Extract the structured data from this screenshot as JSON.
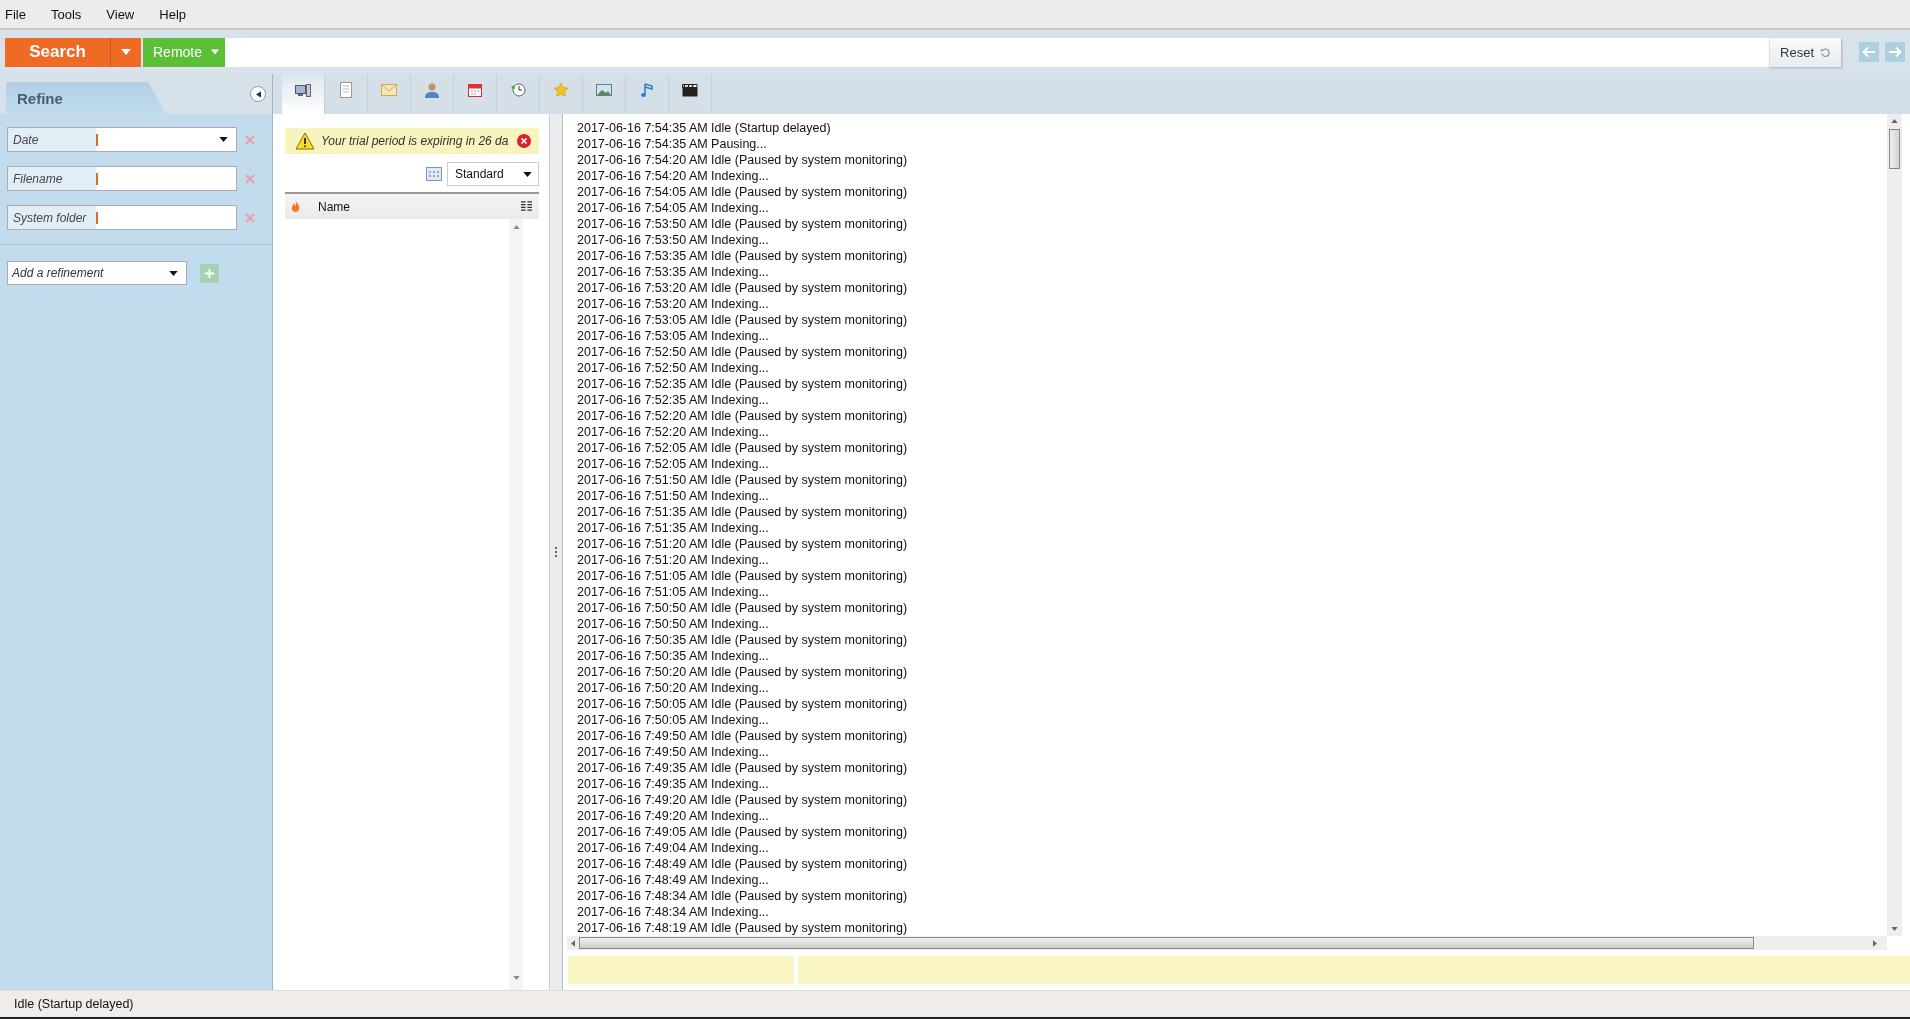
{
  "menu": [
    "File",
    "Tools",
    "View",
    "Help"
  ],
  "toolbar": {
    "search_button": "Search",
    "remote_button": "Remote",
    "reset_button": "Reset"
  },
  "refine": {
    "title": "Refine",
    "filters": [
      {
        "label": "Date",
        "kind": "dropdown"
      },
      {
        "label": "Filename",
        "kind": "text"
      },
      {
        "label": "System folder",
        "kind": "text"
      }
    ],
    "add_refinement": "Add a refinement"
  },
  "tabs": [
    {
      "kind": "computer",
      "selected": true
    },
    {
      "kind": "document",
      "selected": false
    },
    {
      "kind": "email",
      "selected": false
    },
    {
      "kind": "contact",
      "selected": false
    },
    {
      "kind": "calendar",
      "selected": false
    },
    {
      "kind": "history",
      "selected": false
    },
    {
      "kind": "favorite",
      "selected": false
    },
    {
      "kind": "image",
      "selected": false
    },
    {
      "kind": "music",
      "selected": false
    },
    {
      "kind": "video",
      "selected": false
    }
  ],
  "trial_banner": "Your trial period is expiring in 26 da",
  "view_select": "Standard",
  "results_table": {
    "columns": [
      "Name"
    ]
  },
  "log": [
    "2017-06-16 7:54:35 AM Idle (Startup delayed)",
    "2017-06-16 7:54:35 AM Pausing...",
    "2017-06-16 7:54:20 AM Idle (Paused by system monitoring)",
    "2017-06-16 7:54:20 AM Indexing...",
    "2017-06-16 7:54:05 AM Idle (Paused by system monitoring)",
    "2017-06-16 7:54:05 AM Indexing...",
    "2017-06-16 7:53:50 AM Idle (Paused by system monitoring)",
    "2017-06-16 7:53:50 AM Indexing...",
    "2017-06-16 7:53:35 AM Idle (Paused by system monitoring)",
    "2017-06-16 7:53:35 AM Indexing...",
    "2017-06-16 7:53:20 AM Idle (Paused by system monitoring)",
    "2017-06-16 7:53:20 AM Indexing...",
    "2017-06-16 7:53:05 AM Idle (Paused by system monitoring)",
    "2017-06-16 7:53:05 AM Indexing...",
    "2017-06-16 7:52:50 AM Idle (Paused by system monitoring)",
    "2017-06-16 7:52:50 AM Indexing...",
    "2017-06-16 7:52:35 AM Idle (Paused by system monitoring)",
    "2017-06-16 7:52:35 AM Indexing...",
    "2017-06-16 7:52:20 AM Idle (Paused by system monitoring)",
    "2017-06-16 7:52:20 AM Indexing...",
    "2017-06-16 7:52:05 AM Idle (Paused by system monitoring)",
    "2017-06-16 7:52:05 AM Indexing...",
    "2017-06-16 7:51:50 AM Idle (Paused by system monitoring)",
    "2017-06-16 7:51:50 AM Indexing...",
    "2017-06-16 7:51:35 AM Idle (Paused by system monitoring)",
    "2017-06-16 7:51:35 AM Indexing...",
    "2017-06-16 7:51:20 AM Idle (Paused by system monitoring)",
    "2017-06-16 7:51:20 AM Indexing...",
    "2017-06-16 7:51:05 AM Idle (Paused by system monitoring)",
    "2017-06-16 7:51:05 AM Indexing...",
    "2017-06-16 7:50:50 AM Idle (Paused by system monitoring)",
    "2017-06-16 7:50:50 AM Indexing...",
    "2017-06-16 7:50:35 AM Idle (Paused by system monitoring)",
    "2017-06-16 7:50:35 AM Indexing...",
    "2017-06-16 7:50:20 AM Idle (Paused by system monitoring)",
    "2017-06-16 7:50:20 AM Indexing...",
    "2017-06-16 7:50:05 AM Idle (Paused by system monitoring)",
    "2017-06-16 7:50:05 AM Indexing...",
    "2017-06-16 7:49:50 AM Idle (Paused by system monitoring)",
    "2017-06-16 7:49:50 AM Indexing...",
    "2017-06-16 7:49:35 AM Idle (Paused by system monitoring)",
    "2017-06-16 7:49:35 AM Indexing...",
    "2017-06-16 7:49:20 AM Idle (Paused by system monitoring)",
    "2017-06-16 7:49:20 AM Indexing...",
    "2017-06-16 7:49:05 AM Idle (Paused by system monitoring)",
    "2017-06-16 7:49:04 AM Indexing...",
    "2017-06-16 7:48:49 AM Idle (Paused by system monitoring)",
    "2017-06-16 7:48:49 AM Indexing...",
    "2017-06-16 7:48:34 AM Idle (Paused by system monitoring)",
    "2017-06-16 7:48:34 AM Indexing...",
    "2017-06-16 7:48:19 AM Idle (Paused by system monitoring)"
  ],
  "status_bar": "Idle (Startup delayed)"
}
